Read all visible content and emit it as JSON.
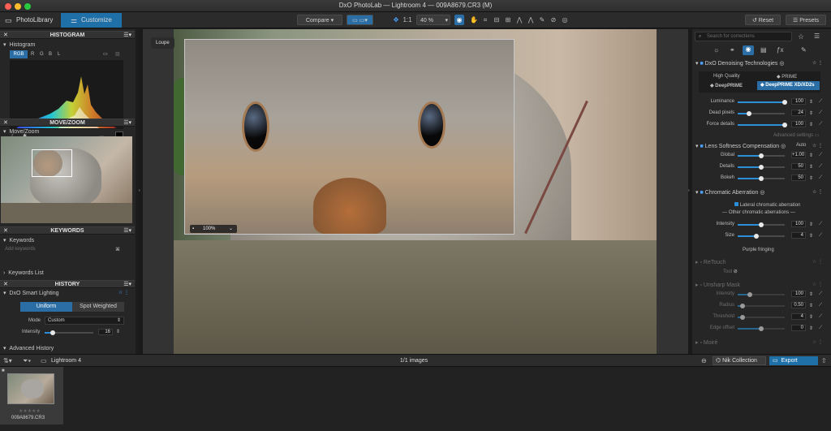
{
  "window": {
    "title": "DxO PhotoLab — Lightroom 4 — 009A8679.CR3 (M)"
  },
  "toolbar": {
    "tab_photolibrary": "PhotoLibrary",
    "tab_customize": "Customize",
    "compare": "Compare",
    "zoom_1to1": "1:1",
    "zoom_value": "40 %",
    "reset": "Reset",
    "presets": "Presets"
  },
  "left": {
    "histogram": {
      "header": "HISTOGRAM",
      "sub": "Histogram",
      "channels": [
        "RGB",
        "R",
        "G",
        "B",
        "L"
      ]
    },
    "movezoom": {
      "header": "MOVE/ZOOM",
      "sub": "Move/Zoom"
    },
    "keywords": {
      "header": "KEYWORDS",
      "sub": "Keywords",
      "placeholder": "Add keywords",
      "list": "Keywords List"
    },
    "history": {
      "header": "HISTORY",
      "tool": "DxO Smart Lighting",
      "uniform": "Uniform",
      "spot": "Spot Weighted",
      "mode_label": "Mode",
      "mode_value": "Custom",
      "intensity_label": "Intensity",
      "intensity_value": "16",
      "intensity_level": 0.16,
      "advanced": "Advanced History"
    }
  },
  "viewer": {
    "loupe": "Loupe",
    "loupe_zoom": "100%"
  },
  "right": {
    "search_placeholder": "Search for corrections",
    "denoise": {
      "title": "DxO Denoising Technologies",
      "hq": "High Quality",
      "prime": "PRIME",
      "deepprime": "DeepPRIME",
      "deepprimexd": "DeepPRIME XD/XD2s",
      "sliders": [
        {
          "label": "Luminance",
          "value": "100",
          "level": 1.0
        },
        {
          "label": "Dead pixels",
          "value": "24",
          "level": 0.24
        },
        {
          "label": "Force details",
          "value": "100",
          "level": 1.0
        }
      ],
      "advanced": "Advanced settings"
    },
    "lens": {
      "title": "Lens Softness Compensation",
      "auto": "Auto",
      "sliders": [
        {
          "label": "Global",
          "value": "+1.00",
          "level": 0.5
        },
        {
          "label": "Details",
          "value": "50",
          "level": 0.5
        },
        {
          "label": "Bokeh",
          "value": "50",
          "level": 0.5
        }
      ]
    },
    "chroma": {
      "title": "Chromatic Aberration",
      "lateral": "Lateral chromatic aberration",
      "other": "Other chromatic aberrations",
      "sliders": [
        {
          "label": "Intensity",
          "value": "100",
          "level": 0.5
        },
        {
          "label": "Size",
          "value": "4",
          "level": 0.4
        }
      ],
      "purple": "Purple fringing"
    },
    "retouch": {
      "title": "ReTouch",
      "tool": "Tool"
    },
    "unsharp": {
      "title": "Unsharp Mask",
      "sliders": [
        {
          "label": "Intensity",
          "value": "100",
          "level": 0.25
        },
        {
          "label": "Radius",
          "value": "0.50",
          "level": 0.1
        },
        {
          "label": "Threshold",
          "value": "4",
          "level": 0.1
        },
        {
          "label": "Edge offset",
          "value": "0",
          "level": 0.5
        }
      ]
    },
    "moire": {
      "title": "Moiré"
    }
  },
  "bottom": {
    "folder": "Lightroom 4",
    "count": "1/1 images",
    "nik": "Nik Collection",
    "export": "Export",
    "thumb_name": "009A8679.CR3",
    "stars": "★★★★★"
  },
  "colors": {
    "accent": "#2a8fd8",
    "panel": "#262626",
    "header": "#333333"
  }
}
